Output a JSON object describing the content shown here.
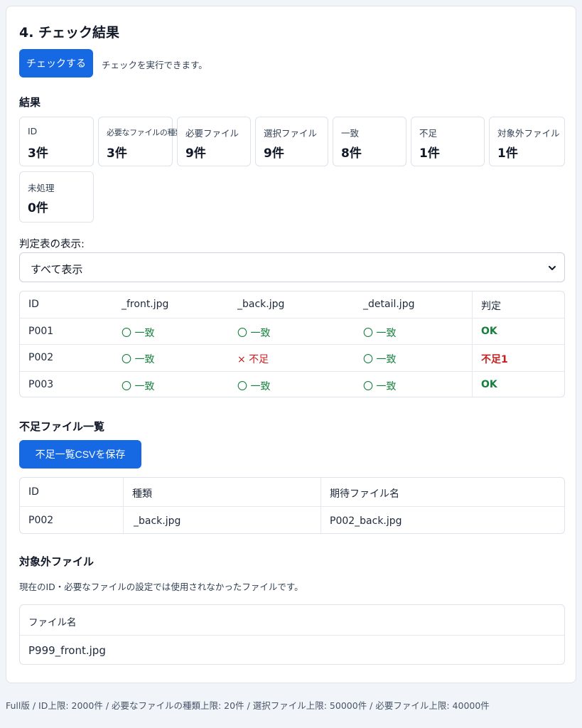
{
  "section": {
    "title": "4. チェック結果",
    "run_button": "チェックする",
    "run_note": "チェックを実行できます。"
  },
  "results": {
    "title": "結果",
    "stats": [
      {
        "label": "ID",
        "value": "3件"
      },
      {
        "label": "必要なファイルの種類",
        "value": "3件"
      },
      {
        "label": "必要ファイル",
        "value": "9件"
      },
      {
        "label": "選択ファイル",
        "value": "9件"
      },
      {
        "label": "一致",
        "value": "8件"
      },
      {
        "label": "不足",
        "value": "1件"
      },
      {
        "label": "対象外ファイル",
        "value": "1件"
      },
      {
        "label": "未処理",
        "value": "0件"
      }
    ]
  },
  "filter": {
    "label": "判定表の表示:",
    "selected": "すべて表示"
  },
  "judge_table": {
    "headers": [
      "ID",
      "_front.jpg",
      "_back.jpg",
      "_detail.jpg",
      "判定"
    ],
    "rows": [
      {
        "id": "P001",
        "front": "〇 一致",
        "back": "〇 一致",
        "detail": "〇 一致",
        "result": "OK"
      },
      {
        "id": "P002",
        "front": "〇 一致",
        "back": "× 不足",
        "detail": "〇 一致",
        "result": "不足1"
      },
      {
        "id": "P003",
        "front": "〇 一致",
        "back": "〇 一致",
        "detail": "〇 一致",
        "result": "OK"
      }
    ]
  },
  "missing": {
    "title": "不足ファイル一覧",
    "csv_button": "不足一覧CSVを保存",
    "headers": [
      "ID",
      "種類",
      "期待ファイル名"
    ],
    "rows": [
      {
        "id": "P002",
        "kind": "_back.jpg",
        "expected": "P002_back.jpg"
      }
    ]
  },
  "outside": {
    "title": "対象外ファイル",
    "note": "現在のID・必要なファイルの設定では使用されなかったファイルです。",
    "header": "ファイル名",
    "rows": [
      "P999_front.jpg"
    ]
  },
  "footer": "Full版 / ID上限: 2000件 / 必要なファイルの種類上限: 20件 / 選択ファイル上限: 50000件 / 必要ファイル上限: 40000件",
  "colors": {
    "primary": "#1668e3",
    "ok": "#15803d",
    "ng": "#c81e1e"
  }
}
